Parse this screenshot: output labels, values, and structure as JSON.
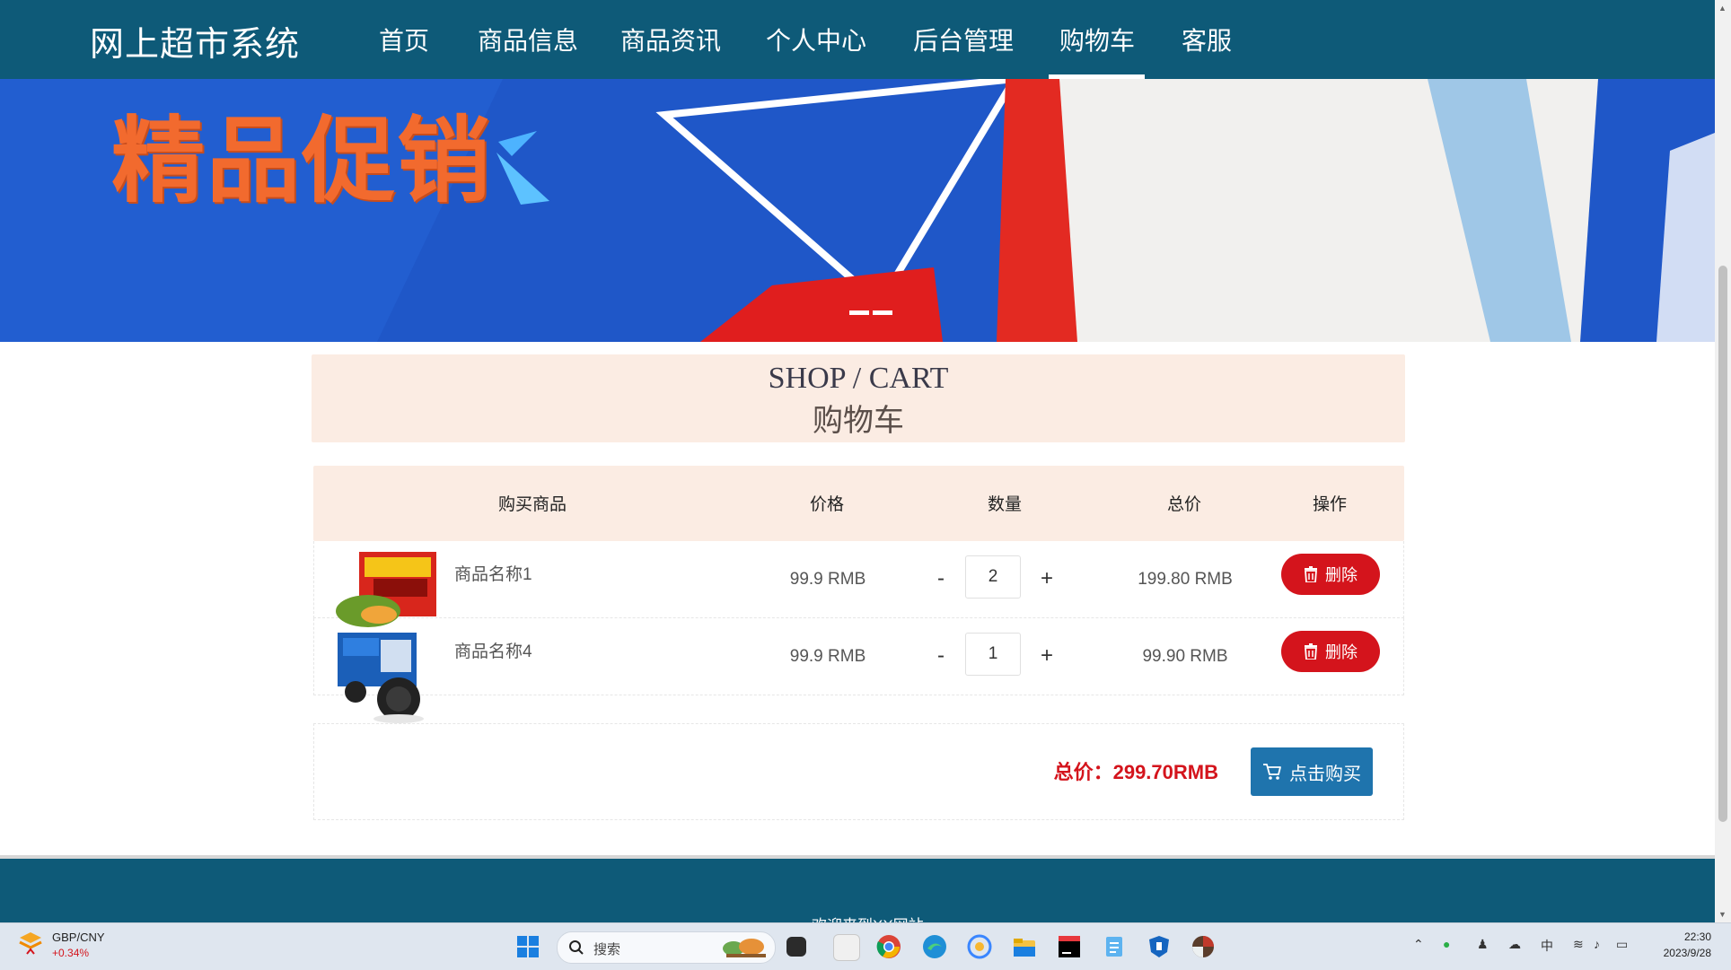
{
  "nav": {
    "brand": "网上超市系统",
    "items": [
      "首页",
      "商品信息",
      "商品资讯",
      "个人中心",
      "后台管理",
      "购物车",
      "客服"
    ],
    "active_index": 5
  },
  "banner": {
    "title": "精品促销",
    "slide_count": 2,
    "colors": {
      "background": "#1f57c8",
      "title": "#f26a2e"
    }
  },
  "cart_header": {
    "title_en": "SHOP / CART",
    "title_cn": "购物车"
  },
  "table": {
    "headers": {
      "product": "购买商品",
      "price": "价格",
      "qty": "数量",
      "subtotal": "总价",
      "action": "操作"
    },
    "rows": [
      {
        "name": "商品名称1",
        "price": "99.9 RMB",
        "minus": "-",
        "qty": "2",
        "plus": "+",
        "subtotal": "199.80 RMB",
        "delete_label": "删除",
        "thumb": "noodle-pack-image"
      },
      {
        "name": "商品名称4",
        "price": "99.9 RMB",
        "minus": "-",
        "qty": "1",
        "plus": "+",
        "subtotal": "99.90 RMB",
        "delete_label": "删除",
        "thumb": "oreo-pack-image"
      }
    ]
  },
  "summary": {
    "total": "总价：299.70RMB",
    "buy_label": "点击购买"
  },
  "footer": {
    "text": "欢迎来到XX网站"
  },
  "taskbar": {
    "ticker_symbol": "GBP/CNY",
    "ticker_change": "+0.34%",
    "search_placeholder": "搜索",
    "time": "22:30",
    "date": "2023/9/28"
  },
  "colors": {
    "nav_bg": "#0e5a78",
    "accent_red": "#d4141c",
    "buy_blue": "#1f74ad",
    "header_peach": "#fbece3"
  }
}
